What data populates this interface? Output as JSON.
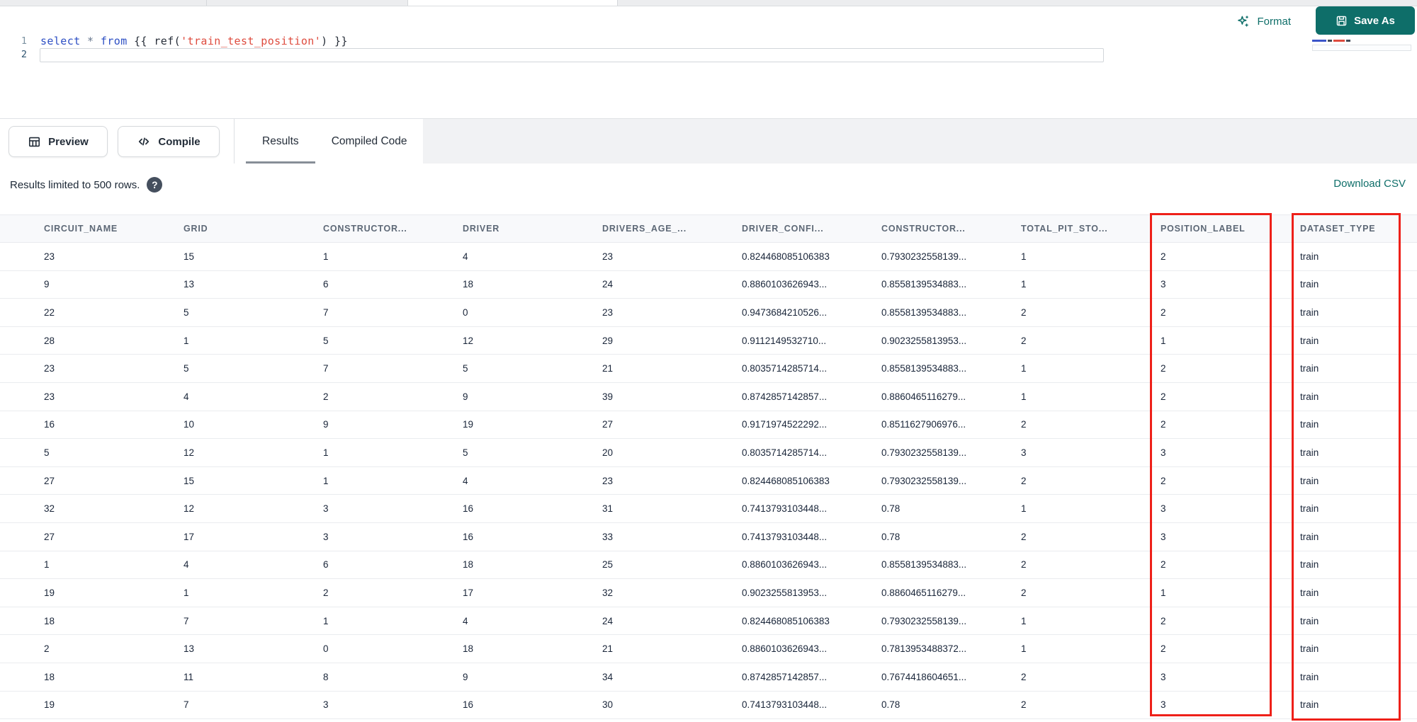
{
  "colors": {
    "accent": "#0e6e69",
    "annotation_red": "#ee2019",
    "keyword_blue": "#2d4fc4",
    "string_red": "#de4b3e"
  },
  "toolbar": {
    "format_label": "Format",
    "save_as_label": "Save As"
  },
  "editor": {
    "line1_number": "1",
    "line2_number": "2",
    "code": {
      "kw_select": "select",
      "ws1": " ",
      "star": "*",
      "ws2": " ",
      "kw_from": "from",
      "jinja_open": " {{ ",
      "fn_ref": "ref(",
      "str": "'train_test_position'",
      "close": ") }}"
    }
  },
  "action_row": {
    "preview_label": "Preview",
    "compile_label": "Compile",
    "tabs": [
      {
        "label": "Results",
        "active": true
      },
      {
        "label": "Compiled Code",
        "active": false
      }
    ]
  },
  "info_row": {
    "results_notice": "Results limited to 500 rows.",
    "help_glyph": "?",
    "download_csv_label": "Download CSV"
  },
  "table": {
    "columns": [
      "CIRCUIT_NAME",
      "GRID",
      "CONSTRUCTOR...",
      "DRIVER",
      "DRIVERS_AGE_...",
      "DRIVER_CONFI...",
      "CONSTRUCTOR...",
      "TOTAL_PIT_STO...",
      "POSITION_LABEL",
      "DATASET_TYPE"
    ],
    "rows": [
      [
        "23",
        "15",
        "1",
        "4",
        "23",
        "0.824468085106383",
        "0.7930232558139...",
        "1",
        "2",
        "train"
      ],
      [
        "9",
        "13",
        "6",
        "18",
        "24",
        "0.8860103626943...",
        "0.8558139534883...",
        "1",
        "3",
        "train"
      ],
      [
        "22",
        "5",
        "7",
        "0",
        "23",
        "0.9473684210526...",
        "0.8558139534883...",
        "2",
        "2",
        "train"
      ],
      [
        "28",
        "1",
        "5",
        "12",
        "29",
        "0.9112149532710...",
        "0.9023255813953...",
        "2",
        "1",
        "train"
      ],
      [
        "23",
        "5",
        "7",
        "5",
        "21",
        "0.8035714285714...",
        "0.8558139534883...",
        "1",
        "2",
        "train"
      ],
      [
        "23",
        "4",
        "2",
        "9",
        "39",
        "0.8742857142857...",
        "0.8860465116279...",
        "1",
        "2",
        "train"
      ],
      [
        "16",
        "10",
        "9",
        "19",
        "27",
        "0.9171974522292...",
        "0.8511627906976...",
        "2",
        "2",
        "train"
      ],
      [
        "5",
        "12",
        "1",
        "5",
        "20",
        "0.8035714285714...",
        "0.7930232558139...",
        "3",
        "3",
        "train"
      ],
      [
        "27",
        "15",
        "1",
        "4",
        "23",
        "0.824468085106383",
        "0.7930232558139...",
        "2",
        "2",
        "train"
      ],
      [
        "32",
        "12",
        "3",
        "16",
        "31",
        "0.7413793103448...",
        "0.78",
        "1",
        "3",
        "train"
      ],
      [
        "27",
        "17",
        "3",
        "16",
        "33",
        "0.7413793103448...",
        "0.78",
        "2",
        "3",
        "train"
      ],
      [
        "1",
        "4",
        "6",
        "18",
        "25",
        "0.8860103626943...",
        "0.8558139534883...",
        "2",
        "2",
        "train"
      ],
      [
        "19",
        "1",
        "2",
        "17",
        "32",
        "0.9023255813953...",
        "0.8860465116279...",
        "2",
        "1",
        "train"
      ],
      [
        "18",
        "7",
        "1",
        "4",
        "24",
        "0.824468085106383",
        "0.7930232558139...",
        "1",
        "2",
        "train"
      ],
      [
        "2",
        "13",
        "0",
        "18",
        "21",
        "0.8860103626943...",
        "0.7813953488372...",
        "1",
        "2",
        "train"
      ],
      [
        "18",
        "11",
        "8",
        "9",
        "34",
        "0.8742857142857...",
        "0.7674418604651...",
        "2",
        "3",
        "train"
      ],
      [
        "19",
        "7",
        "3",
        "16",
        "30",
        "0.7413793103448...",
        "0.78",
        "2",
        "3",
        "train"
      ]
    ],
    "annotations": [
      {
        "target_column": "POSITION_LABEL"
      },
      {
        "target_column": "DATASET_TYPE"
      }
    ]
  }
}
